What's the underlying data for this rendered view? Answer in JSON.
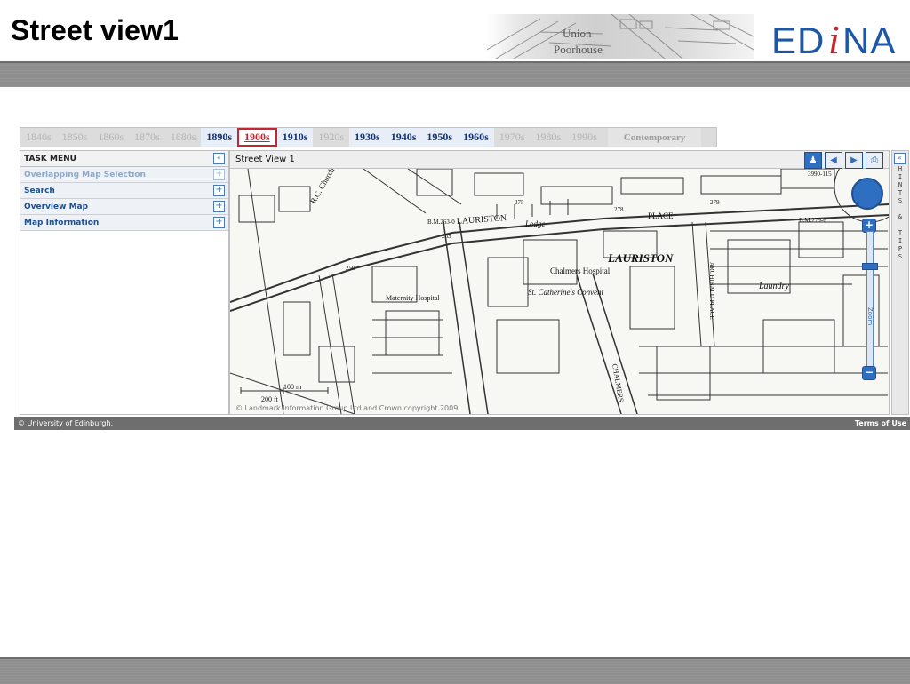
{
  "slide": {
    "title": "Street view1"
  },
  "brand": {
    "logo_text_left": "ED",
    "logo_text_i": "i",
    "logo_text_right": "NA",
    "accent_blue": "#1b57a6",
    "accent_red": "#c2262e"
  },
  "banner": {
    "text_1": "Union",
    "text_2": "Poorhouse"
  },
  "decades": [
    {
      "label": "1840s",
      "available": false,
      "selected": false
    },
    {
      "label": "1850s",
      "available": false,
      "selected": false
    },
    {
      "label": "1860s",
      "available": false,
      "selected": false
    },
    {
      "label": "1870s",
      "available": false,
      "selected": false
    },
    {
      "label": "1880s",
      "available": false,
      "selected": false
    },
    {
      "label": "1890s",
      "available": true,
      "selected": false
    },
    {
      "label": "1900s",
      "available": true,
      "selected": true
    },
    {
      "label": "1910s",
      "available": true,
      "selected": false
    },
    {
      "label": "1920s",
      "available": false,
      "selected": false
    },
    {
      "label": "1930s",
      "available": true,
      "selected": false
    },
    {
      "label": "1940s",
      "available": true,
      "selected": false
    },
    {
      "label": "1950s",
      "available": true,
      "selected": false
    },
    {
      "label": "1960s",
      "available": true,
      "selected": false
    },
    {
      "label": "1970s",
      "available": false,
      "selected": false
    },
    {
      "label": "1980s",
      "available": false,
      "selected": false
    },
    {
      "label": "1990s",
      "available": false,
      "selected": false
    }
  ],
  "contemporary_label": "Contemporary",
  "task_menu": {
    "header": "TASK MENU",
    "collapse_icon": "double-chevron-left-icon",
    "items": [
      {
        "label": "Overlapping Map Selection",
        "enabled": false
      },
      {
        "label": "Search",
        "enabled": true
      },
      {
        "label": "Overview Map",
        "enabled": true
      },
      {
        "label": "Map Information",
        "enabled": true
      }
    ]
  },
  "map": {
    "title": "Street View 1",
    "tools": [
      "person-icon",
      "arrow-left-icon",
      "arrow-right-icon",
      "print-icon"
    ],
    "labels": {
      "street_1": "LAURISTON",
      "street_2": "PLACE",
      "district": "LAURISTON",
      "hospital": "Chalmers Hospital",
      "convent": "St. Catherine's Convent",
      "maternity": "Maternity Hospital",
      "laundry": "Laundry",
      "lodge": "Lodge",
      "chalmers": "CHALMERS",
      "church": "R.C. Church",
      "archibald": "ARCHIBALD PLACE",
      "scale_1": "100 m",
      "scale_2": "200 ft",
      "bench_1": "B.M.263-0",
      "bench_2": "B.M.279-6",
      "num_275": "275",
      "num_278": "278",
      "num_279": "279",
      "num_263": "263",
      "num_250": "250",
      "corner": "3990-115"
    },
    "zoom_label": "Zoom"
  },
  "copyright": "© Landmark Information Group Ltd and Crown copyright 2009",
  "hints": {
    "lines": [
      "H",
      "I",
      "N",
      "T",
      "S",
      "",
      "&",
      "",
      "T",
      "I",
      "P",
      "S"
    ]
  },
  "footer": {
    "left": "© University of Edinburgh.",
    "right": "Terms of Use"
  }
}
